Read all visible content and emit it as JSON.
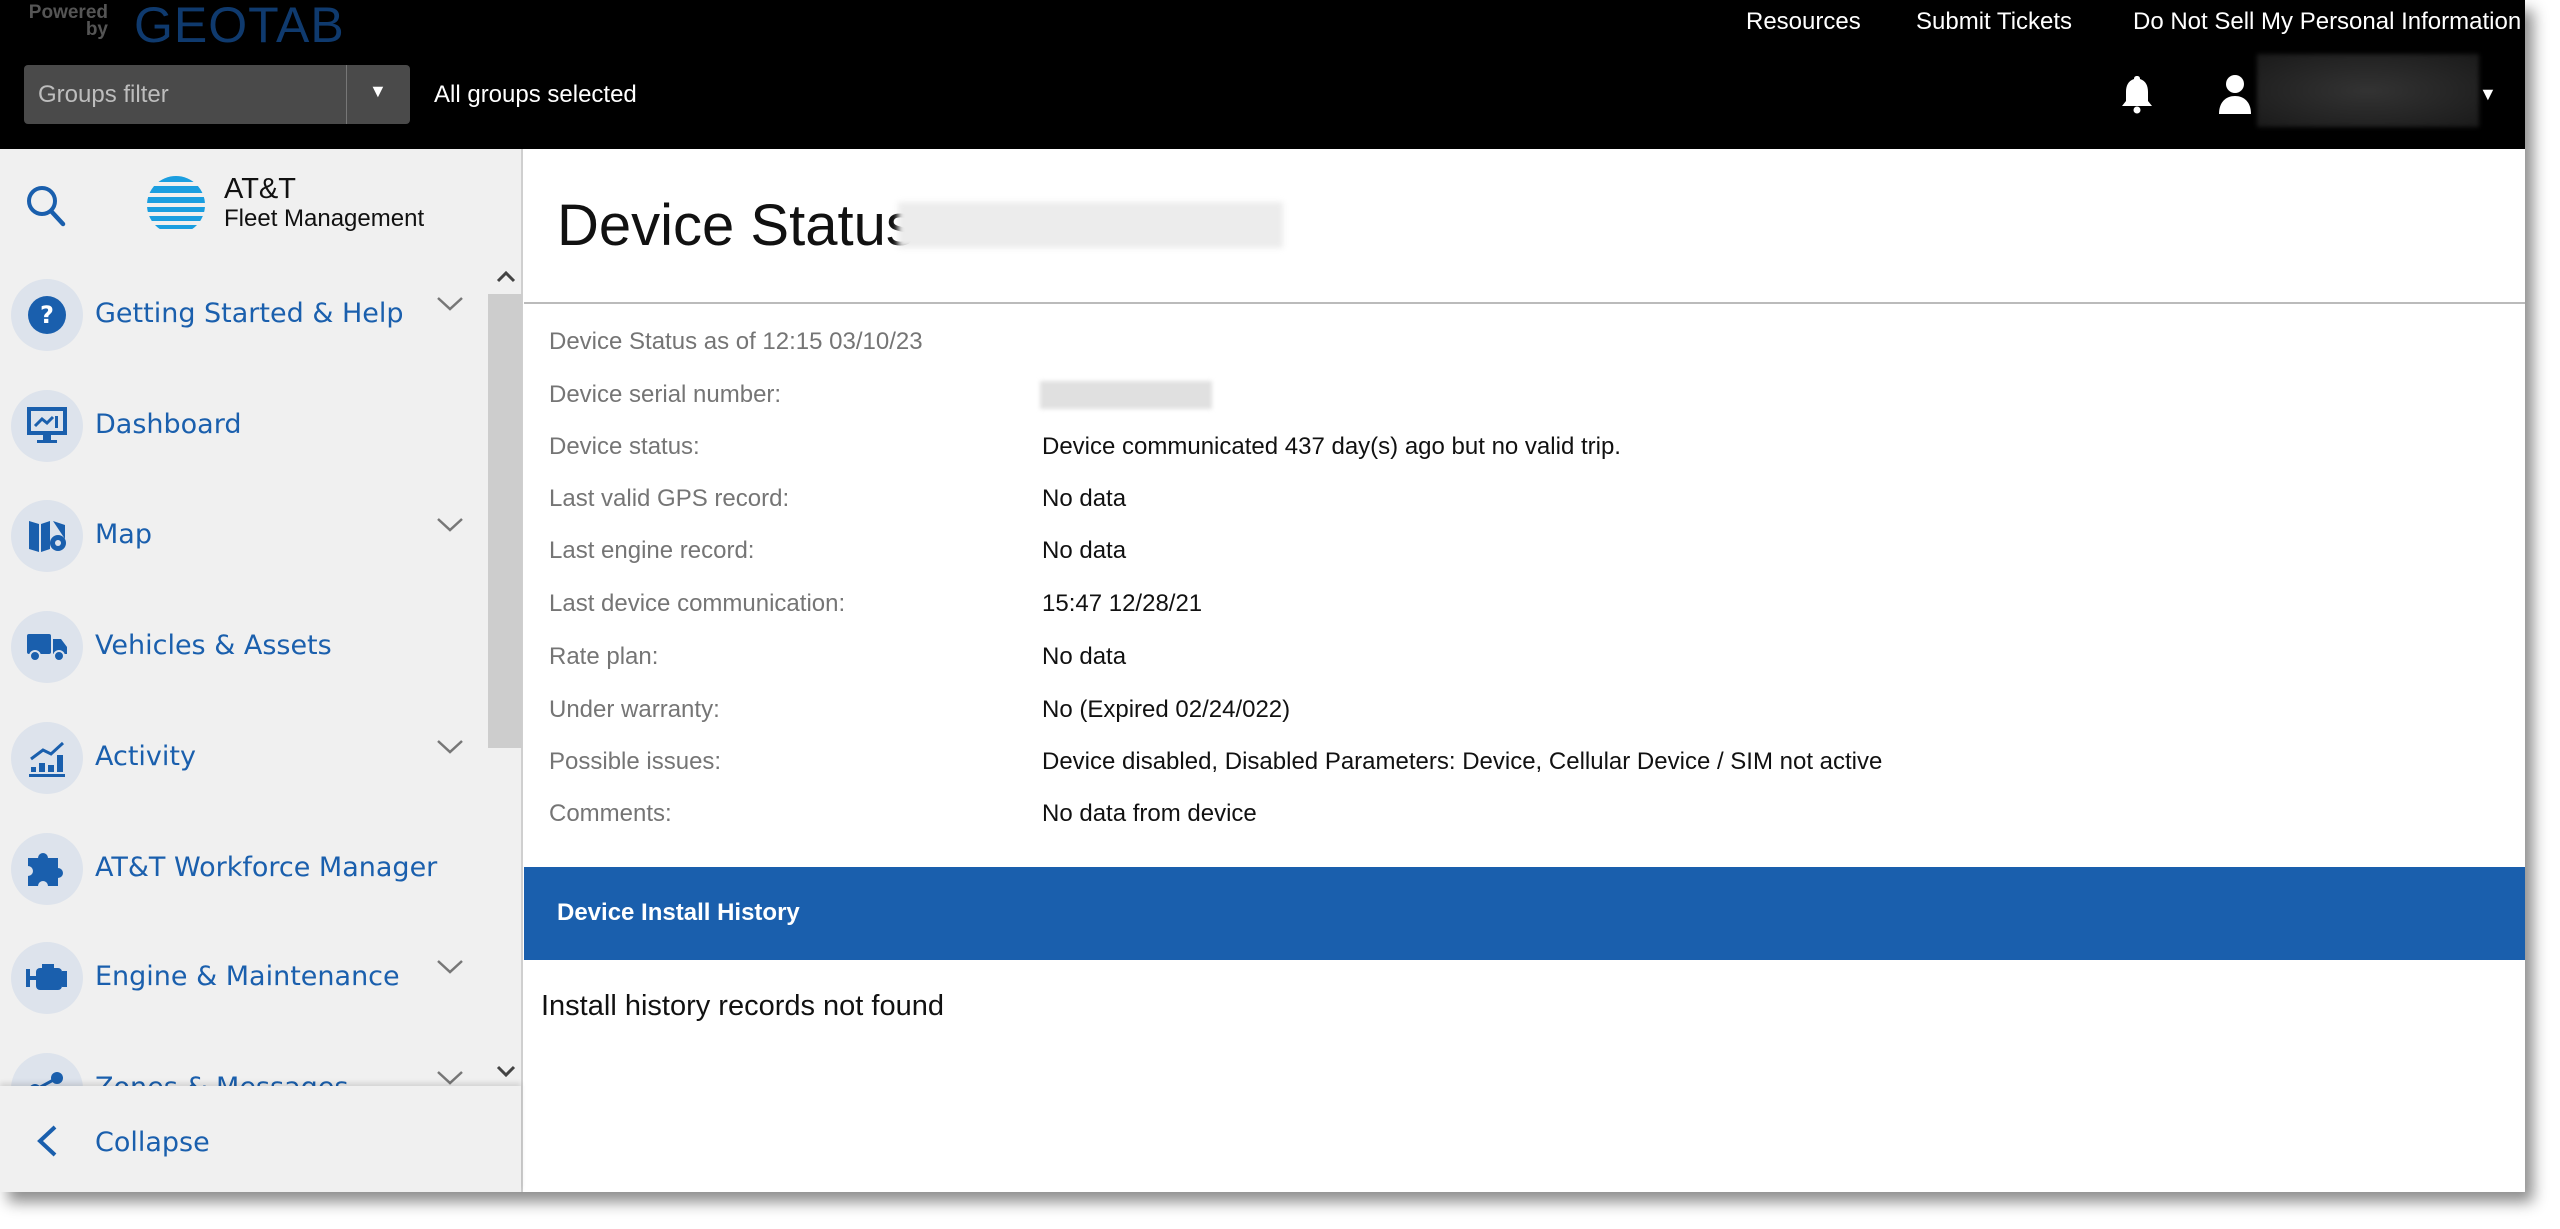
{
  "header": {
    "powered_by": "Powered by",
    "brand": "GEOTAB",
    "groups_filter_placeholder": "Groups filter",
    "groups_status": "All groups selected",
    "links": [
      "Resources",
      "Submit Tickets",
      "Do Not Sell My Personal Information"
    ]
  },
  "sidebar": {
    "logo_line1": "AT&T",
    "logo_line2": "Fleet Management",
    "items": [
      {
        "label": "Getting Started & Help",
        "icon": "help-circle-icon",
        "expandable": true
      },
      {
        "label": "Dashboard",
        "icon": "dashboard-monitor-icon",
        "expandable": false
      },
      {
        "label": "Map",
        "icon": "map-icon",
        "expandable": true
      },
      {
        "label": "Vehicles & Assets",
        "icon": "truck-icon",
        "expandable": false
      },
      {
        "label": "Activity",
        "icon": "activity-chart-icon",
        "expandable": true
      },
      {
        "label": "AT&T Workforce Manager",
        "icon": "puzzle-icon",
        "expandable": false
      },
      {
        "label": "Engine & Maintenance",
        "icon": "engine-icon",
        "expandable": true
      },
      {
        "label": "Zones & Messages",
        "icon": "zones-icon",
        "expandable": true
      }
    ],
    "collapse_label": "Collapse"
  },
  "main": {
    "title": "Device Status",
    "as_of": "Device Status as of 12:15 03/10/23",
    "details": [
      {
        "label": "Device serial number:",
        "value": ""
      },
      {
        "label": "Device status:",
        "value": "Device communicated 437 day(s) ago but no valid trip."
      },
      {
        "label": "Last valid GPS record:",
        "value": "No data"
      },
      {
        "label": "Last engine record:",
        "value": "No data"
      },
      {
        "label": "Last device communication:",
        "value": "15:47 12/28/21"
      },
      {
        "label": "Rate plan:",
        "value": "No data"
      },
      {
        "label": "Under warranty:",
        "value": "No (Expired 02/24/022)"
      },
      {
        "label": "Possible issues:",
        "value": "Device disabled, Disabled Parameters: Device, Cellular Device / SIM not active"
      },
      {
        "label": "Comments:",
        "value": "No data from device"
      }
    ],
    "install_history_title": "Device Install History",
    "install_history_empty": "Install history records not found"
  },
  "colors": {
    "accent": "#1a5fad",
    "topbar": "#000000",
    "sidebar": "#f0f0f0"
  }
}
